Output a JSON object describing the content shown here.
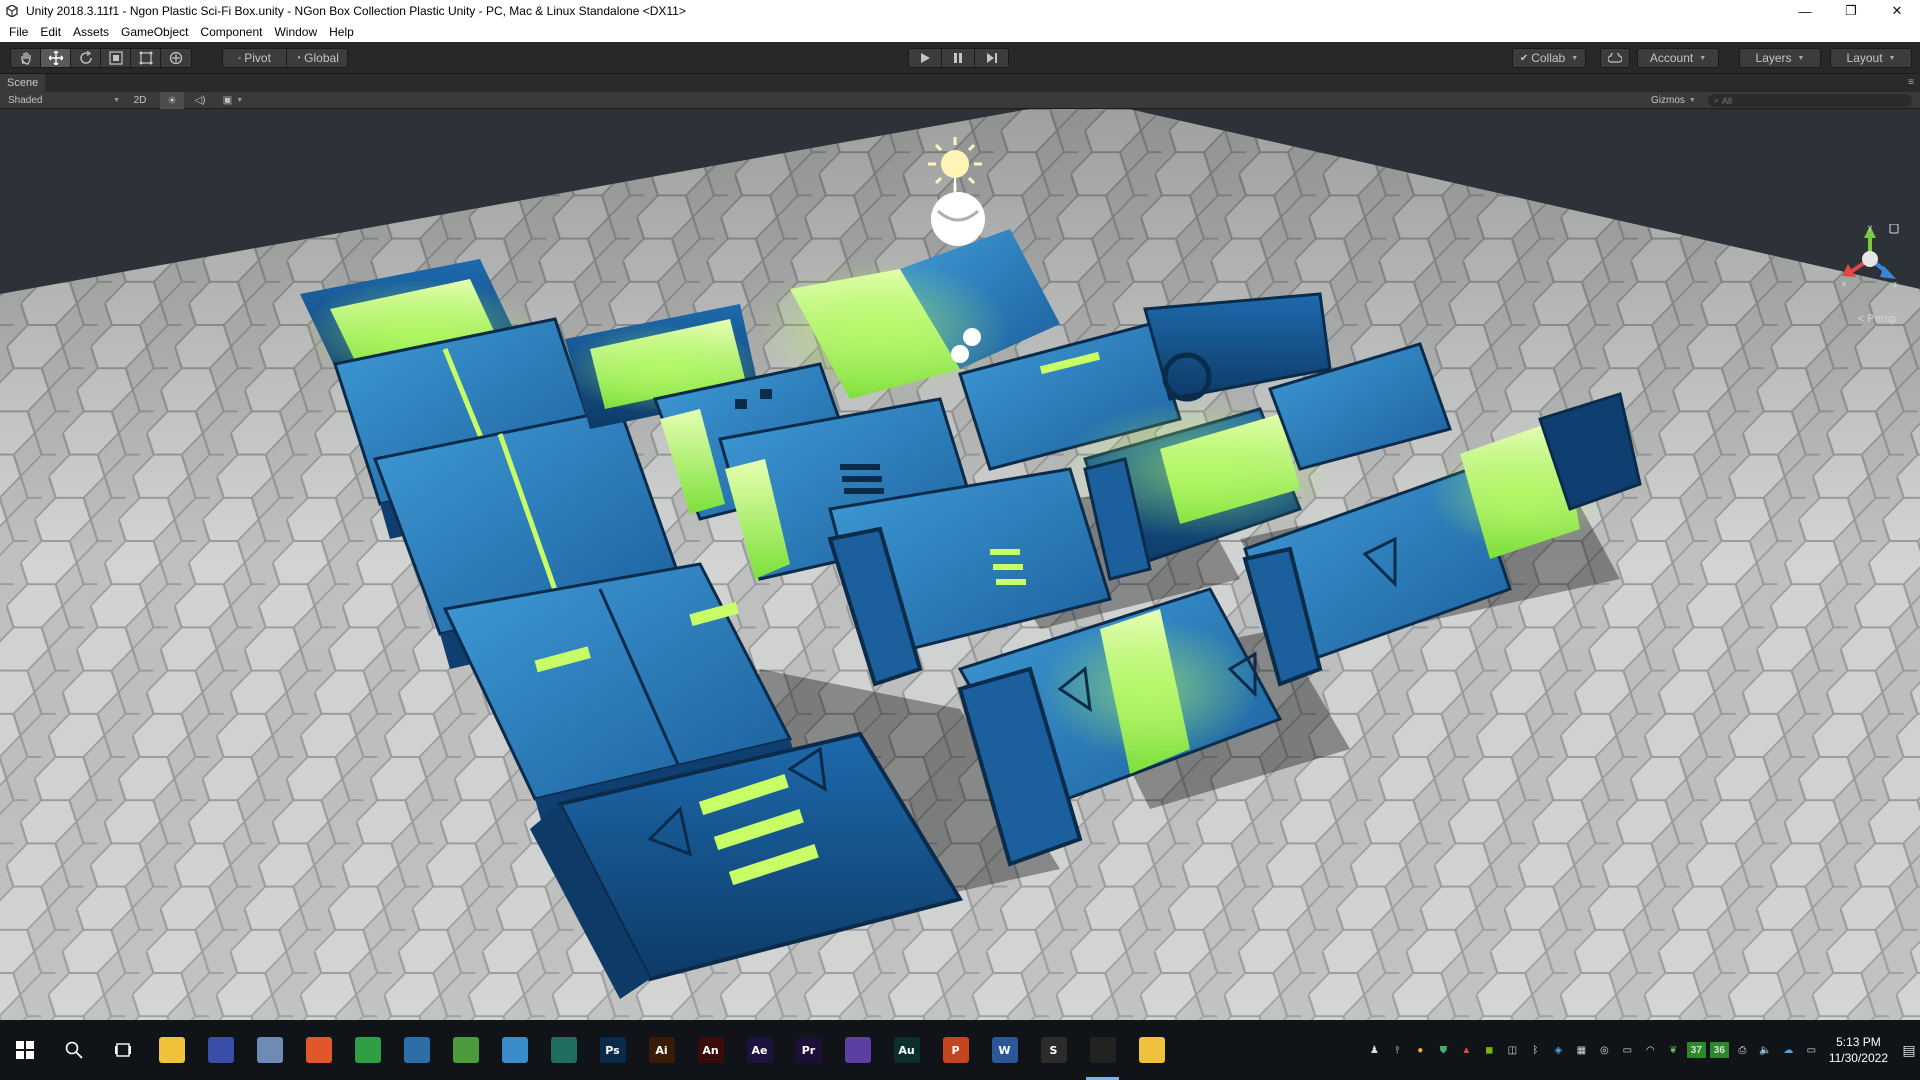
{
  "window": {
    "title": "Unity 2018.3.11f1 - Ngon Plastic Sci-Fi Box.unity - NGon Box Collection Plastic Unity - PC, Mac & Linux Standalone <DX11>",
    "minimize": "—",
    "restore": "❐",
    "close": "✕"
  },
  "menu": [
    "File",
    "Edit",
    "Assets",
    "GameObject",
    "Component",
    "Window",
    "Help"
  ],
  "toolbar": {
    "pivot_label": "Pivot",
    "global_label": "Global",
    "collab_label": "Collab",
    "account_label": "Account",
    "layers_label": "Layers",
    "layout_label": "Layout"
  },
  "scene": {
    "tab_label": "Scene",
    "shading_mode": "Shaded",
    "mode_2d": "2D",
    "gizmos_label": "Gizmos",
    "search_placeholder": "All",
    "projection_label": "Persp",
    "axis_y": "y",
    "axis_z": "z",
    "axis_x": "x"
  },
  "taskbar": {
    "apps": [
      {
        "name": "file-explorer",
        "label": "",
        "color": "#f0c23b"
      },
      {
        "name": "unity-hub",
        "label": "",
        "color": "#3a4ea8"
      },
      {
        "name": "paint-tool",
        "label": "",
        "color": "#6d8bb5"
      },
      {
        "name": "firefox",
        "label": "",
        "color": "#e2562b"
      },
      {
        "name": "chrome",
        "label": "",
        "color": "#2f9e44"
      },
      {
        "name": "search-app",
        "label": "",
        "color": "#2d6ea8"
      },
      {
        "name": "globe-app",
        "label": "",
        "color": "#4b9c3a"
      },
      {
        "name": "earth-app",
        "label": "",
        "color": "#3a8dc8"
      },
      {
        "name": "terminal-app",
        "label": "",
        "color": "#1f6e60"
      },
      {
        "name": "photoshop",
        "label": "Ps",
        "color": "#0a2a4b"
      },
      {
        "name": "illustrator",
        "label": "Ai",
        "color": "#3a1b08"
      },
      {
        "name": "animate",
        "label": "An",
        "color": "#3a0d0d"
      },
      {
        "name": "after-effects",
        "label": "Ae",
        "color": "#1d1340"
      },
      {
        "name": "premiere",
        "label": "Pr",
        "color": "#1d0f3a"
      },
      {
        "name": "vector-app",
        "label": "",
        "color": "#5c3fa0"
      },
      {
        "name": "audition",
        "label": "Au",
        "color": "#0b2f2a"
      },
      {
        "name": "powerpoint",
        "label": "P",
        "color": "#c4461f"
      },
      {
        "name": "word",
        "label": "W",
        "color": "#2b5797"
      },
      {
        "name": "sublime",
        "label": "S",
        "color": "#2b2b2b"
      },
      {
        "name": "unity-editor",
        "label": "",
        "color": "#222222",
        "active": true
      },
      {
        "name": "folder",
        "label": "",
        "color": "#f0c23b"
      }
    ],
    "tray_counts": {
      "badge_1": "37",
      "badge_2": "36"
    },
    "time": "5:13 PM",
    "date": "11/30/2022"
  }
}
